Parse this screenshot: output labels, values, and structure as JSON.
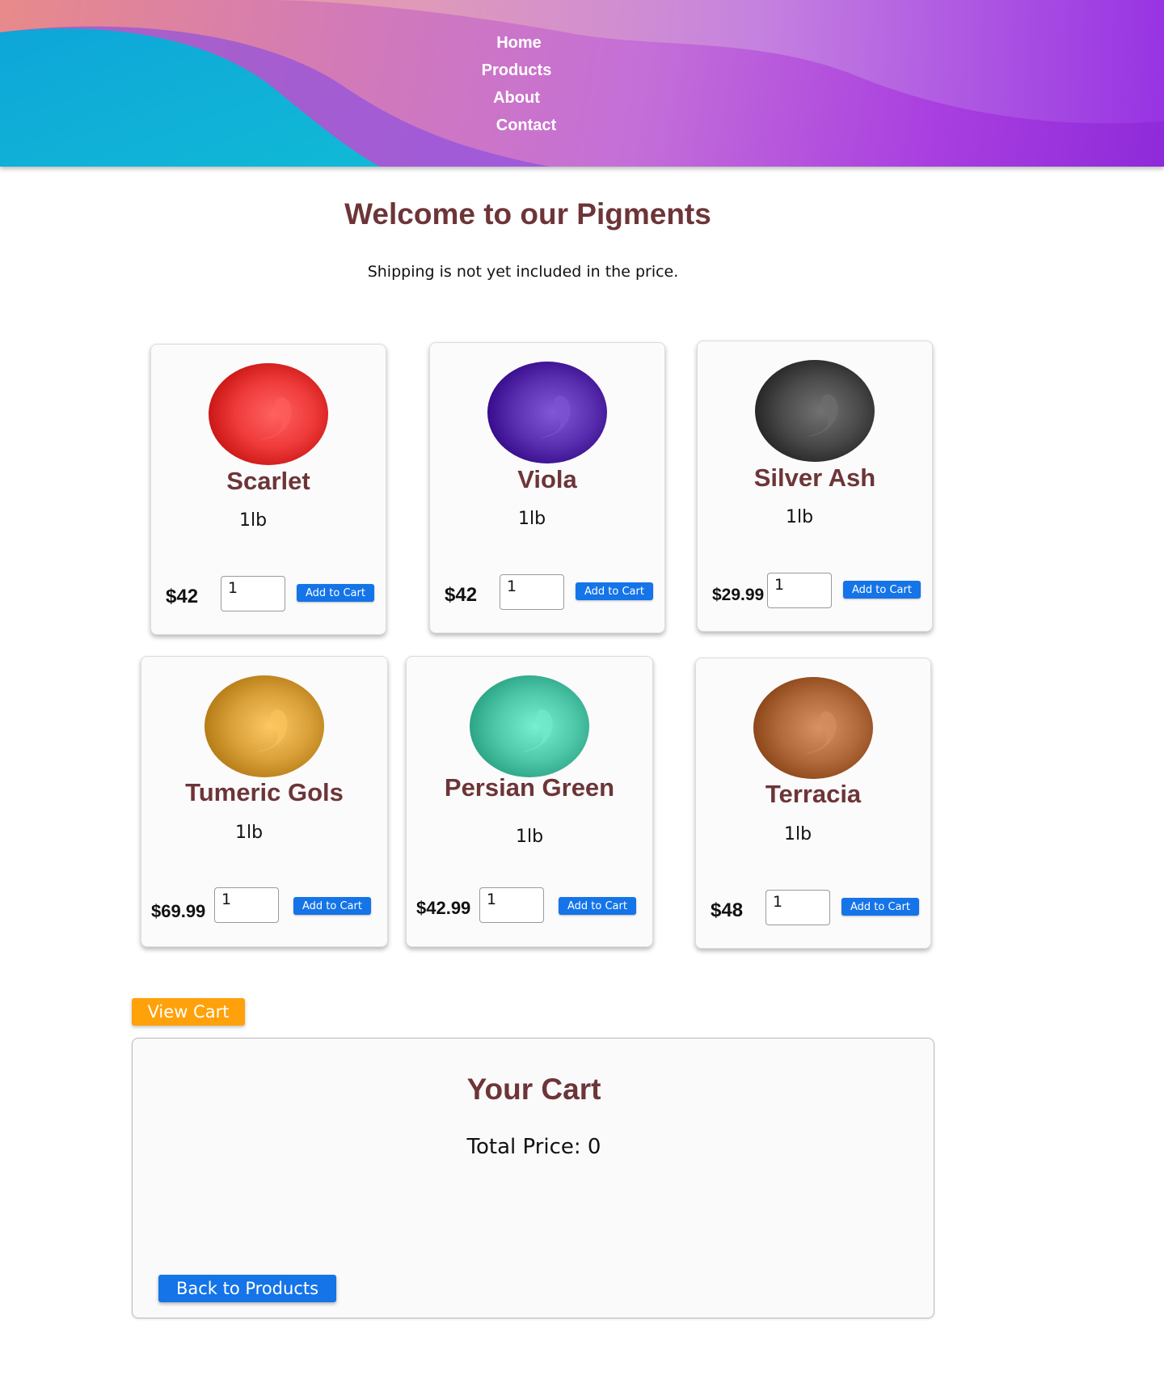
{
  "nav": {
    "items": [
      "Home",
      "Products",
      "About",
      "Contact"
    ]
  },
  "page": {
    "title": "Welcome to our Pigments",
    "subtitle": "Shipping is not yet included in the price."
  },
  "products": [
    {
      "name": "Scarlet",
      "weight": "1lb",
      "price": "$42",
      "quantity": "1",
      "add_label": "Add to Cart",
      "color": "#ef3a3a"
    },
    {
      "name": "Viola",
      "weight": "1lb",
      "price": "$42",
      "quantity": "1",
      "add_label": "Add to Cart",
      "color": "#5a2fb0"
    },
    {
      "name": "Silver Ash",
      "weight": "1lb",
      "price": "$29.99",
      "quantity": "1",
      "add_label": "Add to Cart",
      "color": "#4a4a4a"
    },
    {
      "name": "Tumeric Gols",
      "weight": "1lb",
      "price": "$69.99",
      "quantity": "1",
      "add_label": "Add to Cart",
      "color": "#d9a03a"
    },
    {
      "name": "Persian Green",
      "weight": "1lb",
      "price": "$42.99",
      "quantity": "1",
      "add_label": "Add to Cart",
      "color": "#4fc7a9"
    },
    {
      "name": "Terracia",
      "weight": "1lb",
      "price": "$48",
      "quantity": "1",
      "add_label": "Add to Cart",
      "color": "#b06a3c"
    }
  ],
  "cart": {
    "view_label": "View Cart",
    "title": "Your Cart",
    "total_label": "Total Price: 0",
    "back_label": "Back to Products"
  },
  "colors": {
    "heading": "#6d3538",
    "primary_button": "#1474e8",
    "view_cart_button": "#ffa10a"
  }
}
